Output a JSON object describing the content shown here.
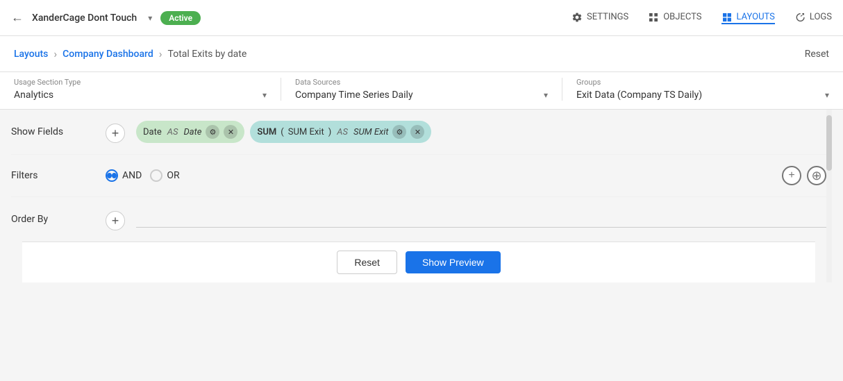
{
  "topNav": {
    "backLabel": "←",
    "projectName": "XanderCage Dont Touch",
    "dropdownArrow": "▾",
    "activeBadge": "Active",
    "navItems": [
      {
        "id": "settings",
        "label": "SETTINGS",
        "icon": "gear"
      },
      {
        "id": "objects",
        "label": "OBJECTS",
        "icon": "grid"
      },
      {
        "id": "layouts",
        "label": "LAYOUTS",
        "icon": "layout",
        "active": true
      },
      {
        "id": "logs",
        "label": "LOGS",
        "icon": "clock"
      }
    ]
  },
  "breadcrumb": {
    "items": [
      {
        "label": "Layouts",
        "active": false
      },
      {
        "label": "Company Dashboard",
        "active": false
      },
      {
        "label": "Total Exits by date",
        "active": true
      }
    ],
    "resetLabel": "Reset"
  },
  "sectionTypeBar": {
    "usageSectionType": {
      "label": "Usage Section Type",
      "value": "Analytics"
    },
    "dataSources": {
      "label": "Data Sources",
      "value": "Company Time Series Daily"
    },
    "groups": {
      "label": "Groups",
      "value": "Exit Data (Company TS Daily)"
    }
  },
  "showFields": {
    "label": "Show Fields",
    "addIcon": "+",
    "pills": [
      {
        "id": "date-pill",
        "type": "green",
        "mainLabel": "Date",
        "asText": "AS",
        "alias": "Date",
        "func": null
      },
      {
        "id": "sum-pill",
        "type": "teal",
        "func": "SUM",
        "openParen": "(",
        "mainLabel": "SUM Exit",
        "closeParen": ")",
        "asText": "AS",
        "alias": "SUM Exit",
        "func2": null
      }
    ]
  },
  "filters": {
    "label": "Filters",
    "radioOptions": [
      {
        "id": "and",
        "label": "AND",
        "selected": true
      },
      {
        "id": "or",
        "label": "OR",
        "selected": false
      }
    ],
    "addButtons": [
      "+",
      "⊕"
    ]
  },
  "orderBy": {
    "label": "Order By",
    "addIcon": "+"
  },
  "bottomBar": {
    "resetLabel": "Reset",
    "showPreviewLabel": "Show Preview"
  }
}
